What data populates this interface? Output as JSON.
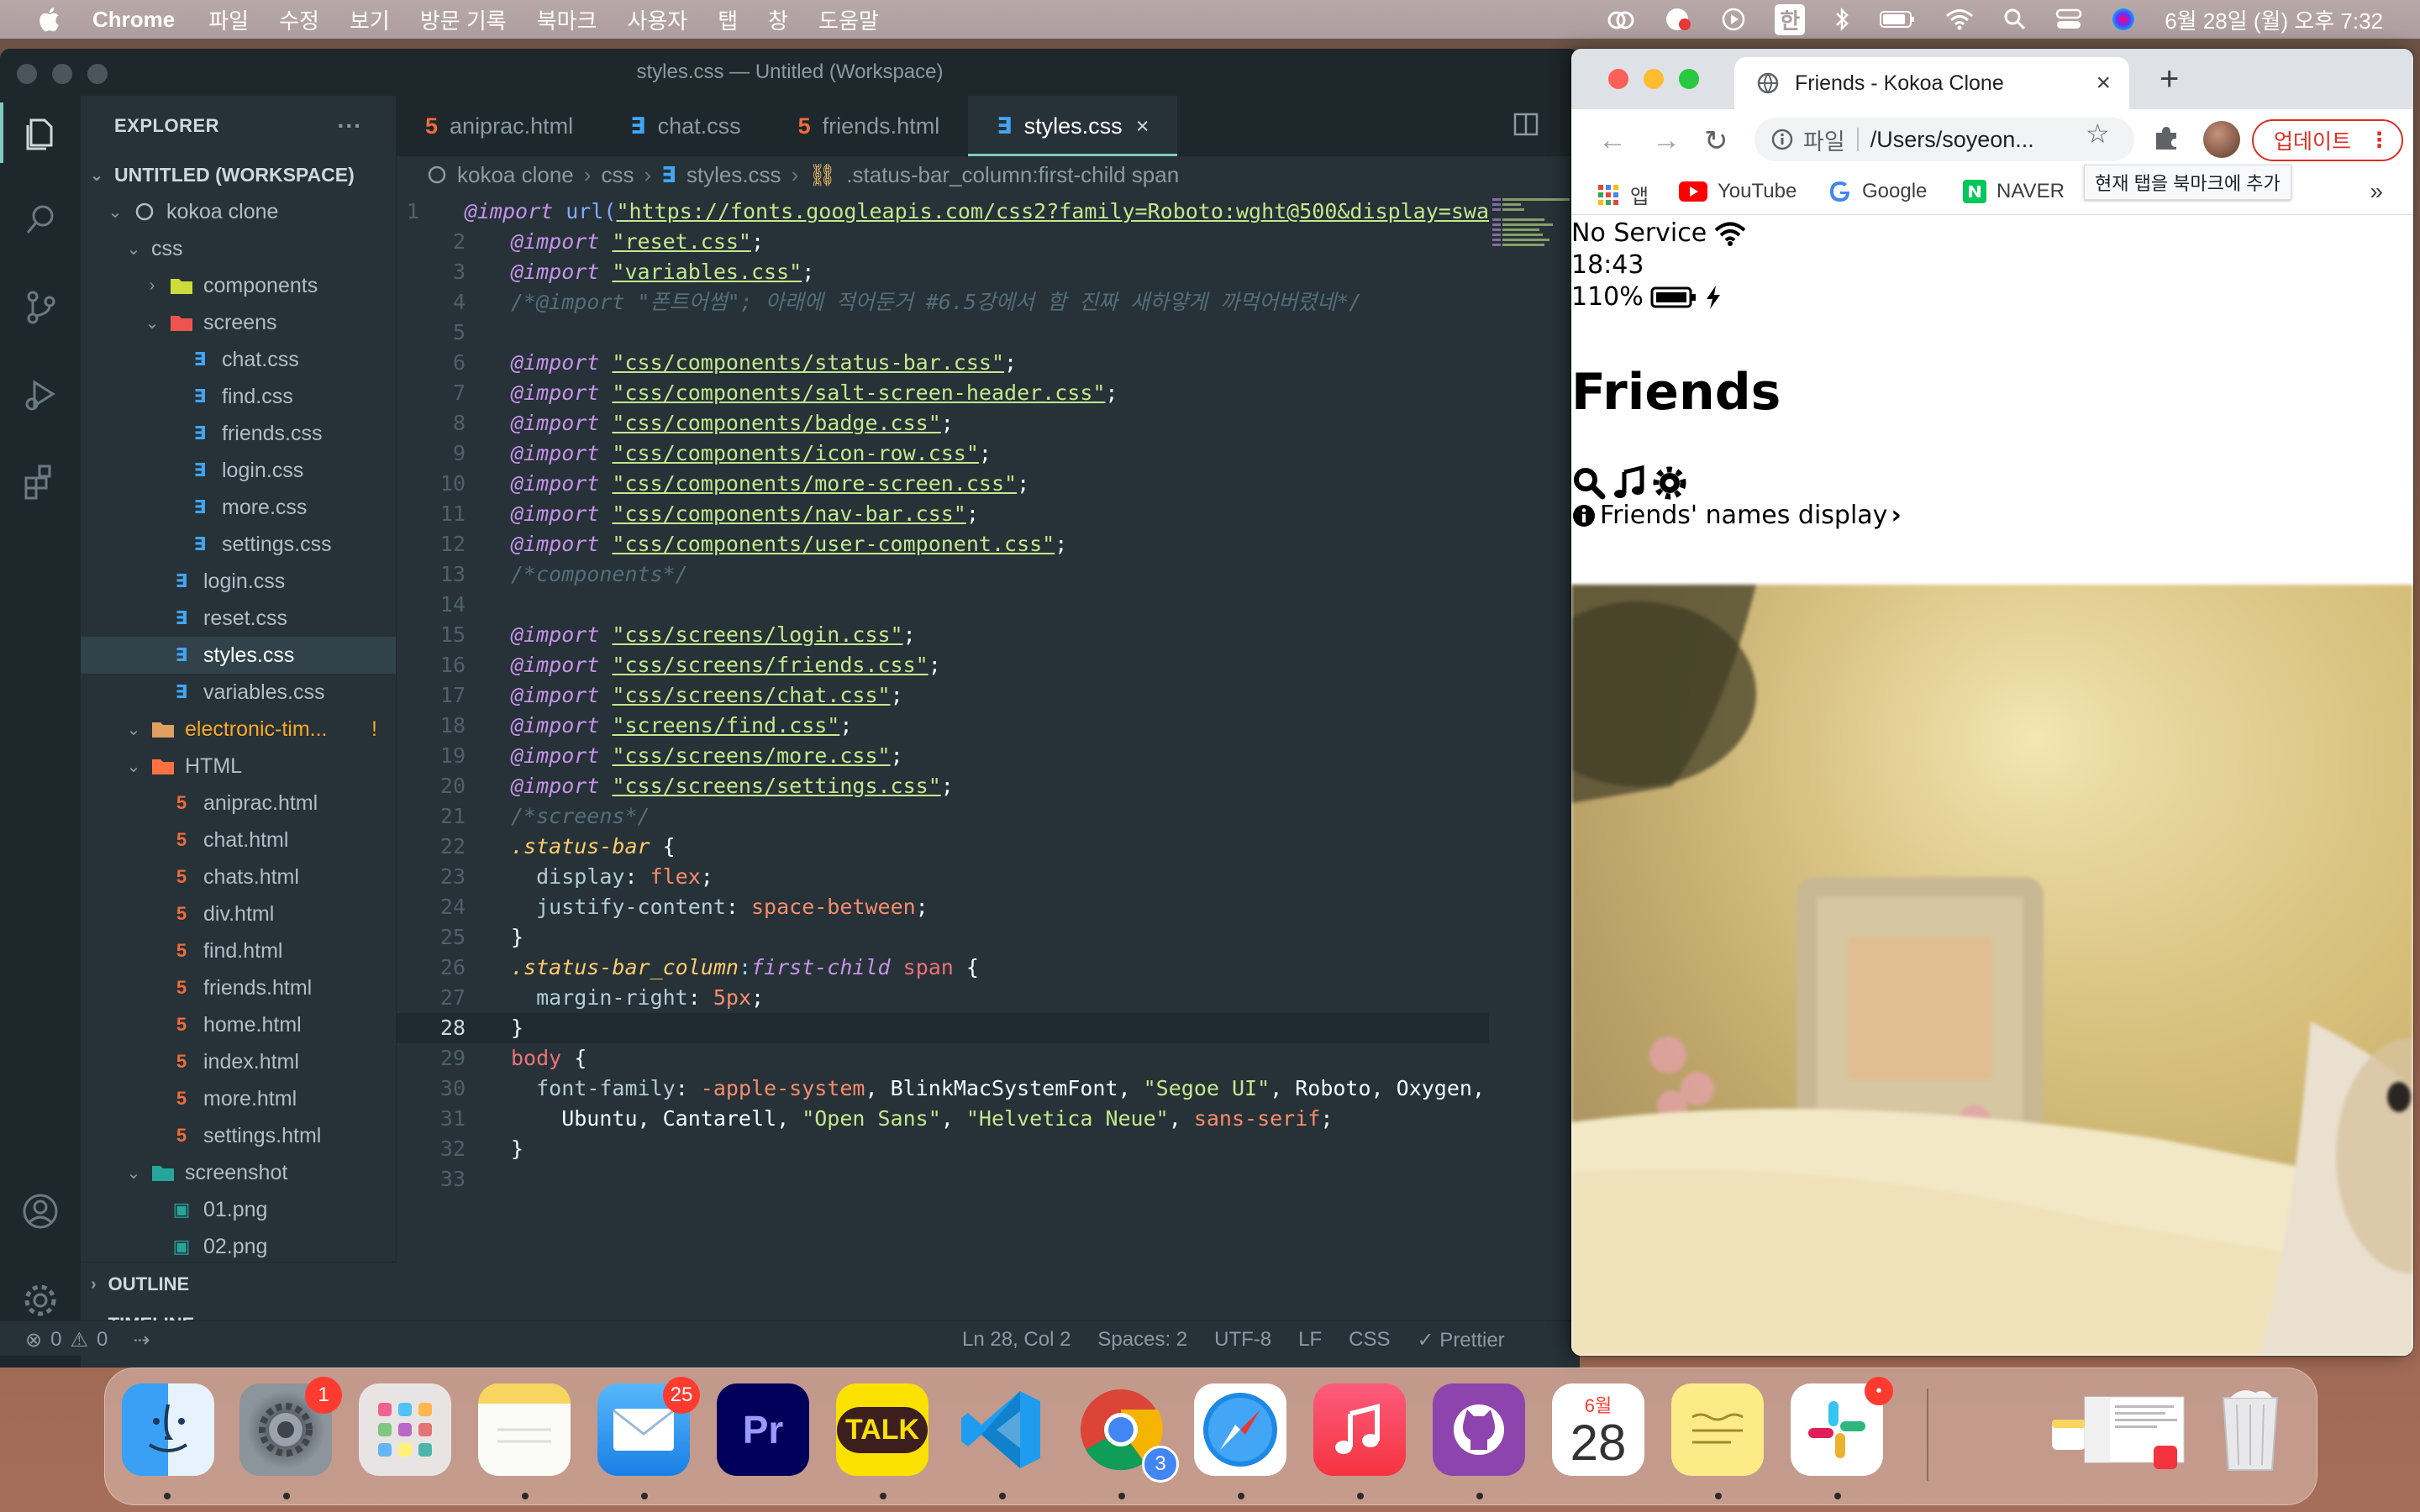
{
  "menubar": {
    "app_name": "Chrome",
    "menus": [
      "파일",
      "수정",
      "보기",
      "방문 기록",
      "북마크",
      "사용자",
      "탭",
      "창",
      "도움말"
    ],
    "input_method": "한",
    "clock": "6월 28일 (월) 오후 7:32"
  },
  "vscode": {
    "title": "styles.css — Untitled (Workspace)",
    "explorer": {
      "header": "EXPLORER",
      "more": "···",
      "workspace": "UNTITLED (WORKSPACE)",
      "items": [
        {
          "label": "kokoa clone",
          "type": "root",
          "depth": 1,
          "expanded": true
        },
        {
          "label": "css",
          "type": "folder",
          "depth": 2,
          "expanded": true
        },
        {
          "label": "components",
          "type": "folder",
          "depth": 3,
          "expanded": false
        },
        {
          "label": "screens",
          "type": "folder",
          "depth": 3,
          "expanded": true
        },
        {
          "label": "chat.css",
          "type": "css",
          "depth": 4
        },
        {
          "label": "find.css",
          "type": "css",
          "depth": 4
        },
        {
          "label": "friends.css",
          "type": "css",
          "depth": 4
        },
        {
          "label": "login.css",
          "type": "css",
          "depth": 4
        },
        {
          "label": "more.css",
          "type": "css",
          "depth": 4
        },
        {
          "label": "settings.css",
          "type": "css",
          "depth": 4
        },
        {
          "label": "login.css",
          "type": "css",
          "depth": 3
        },
        {
          "label": "reset.css",
          "type": "css",
          "depth": 3
        },
        {
          "label": "styles.css",
          "type": "css",
          "depth": 3,
          "selected": true
        },
        {
          "label": "variables.css",
          "type": "css",
          "depth": 3
        },
        {
          "label": "electronic-tim...",
          "type": "folder-warn",
          "depth": 2,
          "expanded": true,
          "badge": "!"
        },
        {
          "label": "HTML",
          "type": "folder",
          "depth": 2,
          "expanded": true
        },
        {
          "label": "aniprac.html",
          "type": "html",
          "depth": 3
        },
        {
          "label": "chat.html",
          "type": "html",
          "depth": 3
        },
        {
          "label": "chats.html",
          "type": "html",
          "depth": 3
        },
        {
          "label": "div.html",
          "type": "html",
          "depth": 3
        },
        {
          "label": "find.html",
          "type": "html",
          "depth": 3
        },
        {
          "label": "friends.html",
          "type": "html",
          "depth": 3
        },
        {
          "label": "home.html",
          "type": "html",
          "depth": 3
        },
        {
          "label": "index.html",
          "type": "html",
          "depth": 3
        },
        {
          "label": "more.html",
          "type": "html",
          "depth": 3
        },
        {
          "label": "settings.html",
          "type": "html",
          "depth": 3
        },
        {
          "label": "screenshot",
          "type": "folder",
          "depth": 2,
          "expanded": true
        },
        {
          "label": "01.png",
          "type": "png",
          "depth": 3
        },
        {
          "label": "02.png",
          "type": "png",
          "depth": 3
        }
      ],
      "outline": "OUTLINE",
      "timeline": "TIMELINE"
    },
    "tabs": [
      {
        "label": "aniprac.html",
        "type": "html",
        "active": false
      },
      {
        "label": "chat.css",
        "type": "css",
        "active": false
      },
      {
        "label": "friends.html",
        "type": "html",
        "active": false
      },
      {
        "label": "styles.css",
        "type": "css",
        "active": true
      }
    ],
    "breadcrumb": [
      "kokoa clone",
      "css",
      "styles.css",
      ".status-bar_column:first-child span"
    ],
    "code": [
      [
        [
          "kw",
          "@import"
        ],
        [
          "t",
          " "
        ],
        [
          "fn",
          "url("
        ],
        [
          "str",
          "\"https://fonts.googleapis.com/css2?family=Roboto:wght@500&display=swa"
        ]
      ],
      [
        [
          "kw",
          "@import"
        ],
        [
          "t",
          " "
        ],
        [
          "str",
          "\"reset.css\""
        ],
        [
          "t",
          ";"
        ]
      ],
      [
        [
          "kw",
          "@import"
        ],
        [
          "t",
          " "
        ],
        [
          "str",
          "\"variables.css\""
        ],
        [
          "t",
          ";"
        ]
      ],
      [
        [
          "cm",
          "/*@import \"폰트어썸\"; 아래에 적어둔거 #6.5강에서 함 진짜 새하얗게 까먹어버렸네*/"
        ]
      ],
      [],
      [
        [
          "kw",
          "@import"
        ],
        [
          "t",
          " "
        ],
        [
          "str",
          "\"css/components/status-bar.css\""
        ],
        [
          "t",
          ";"
        ]
      ],
      [
        [
          "kw",
          "@import"
        ],
        [
          "t",
          " "
        ],
        [
          "str",
          "\"css/components/salt-screen-header.css\""
        ],
        [
          "t",
          ";"
        ]
      ],
      [
        [
          "kw",
          "@import"
        ],
        [
          "t",
          " "
        ],
        [
          "str",
          "\"css/components/badge.css\""
        ],
        [
          "t",
          ";"
        ]
      ],
      [
        [
          "kw",
          "@import"
        ],
        [
          "t",
          " "
        ],
        [
          "str",
          "\"css/components/icon-row.css\""
        ],
        [
          "t",
          ";"
        ]
      ],
      [
        [
          "kw",
          "@import"
        ],
        [
          "t",
          " "
        ],
        [
          "str",
          "\"css/components/more-screen.css\""
        ],
        [
          "t",
          ";"
        ]
      ],
      [
        [
          "kw",
          "@import"
        ],
        [
          "t",
          " "
        ],
        [
          "str",
          "\"css/components/nav-bar.css\""
        ],
        [
          "t",
          ";"
        ]
      ],
      [
        [
          "kw",
          "@import"
        ],
        [
          "t",
          " "
        ],
        [
          "str",
          "\"css/components/user-component.css\""
        ],
        [
          "t",
          ";"
        ]
      ],
      [
        [
          "cm",
          "/*components*/"
        ]
      ],
      [],
      [
        [
          "kw",
          "@import"
        ],
        [
          "t",
          " "
        ],
        [
          "str",
          "\"css/screens/login.css\""
        ],
        [
          "t",
          ";"
        ]
      ],
      [
        [
          "kw",
          "@import"
        ],
        [
          "t",
          " "
        ],
        [
          "str",
          "\"css/screens/friends.css\""
        ],
        [
          "t",
          ";"
        ]
      ],
      [
        [
          "kw",
          "@import"
        ],
        [
          "t",
          " "
        ],
        [
          "str",
          "\"css/screens/chat.css\""
        ],
        [
          "t",
          ";"
        ]
      ],
      [
        [
          "kw",
          "@import"
        ],
        [
          "t",
          " "
        ],
        [
          "str",
          "\"screens/find.css\""
        ],
        [
          "t",
          ";"
        ]
      ],
      [
        [
          "kw",
          "@import"
        ],
        [
          "t",
          " "
        ],
        [
          "str",
          "\"css/screens/more.css\""
        ],
        [
          "t",
          ";"
        ]
      ],
      [
        [
          "kw",
          "@import"
        ],
        [
          "t",
          " "
        ],
        [
          "str",
          "\"css/screens/settings.css\""
        ],
        [
          "t",
          ";"
        ]
      ],
      [
        [
          "cm",
          "/*screens*/"
        ]
      ],
      [
        [
          "sel",
          ".status-bar"
        ],
        [
          "t",
          " {"
        ]
      ],
      [
        [
          "t",
          "  "
        ],
        [
          "pr",
          "display"
        ],
        [
          "t",
          ": "
        ],
        [
          "val",
          "flex"
        ],
        [
          "t",
          ";"
        ]
      ],
      [
        [
          "t",
          "  "
        ],
        [
          "pr",
          "justify-content"
        ],
        [
          "t",
          ": "
        ],
        [
          "val",
          "space-between"
        ],
        [
          "t",
          ";"
        ]
      ],
      [
        [
          "t",
          "}"
        ]
      ],
      [
        [
          "sel",
          ".status-bar_column"
        ],
        [
          "pun",
          ":"
        ],
        [
          "kw",
          "first-child"
        ],
        [
          "t",
          " "
        ],
        [
          "tag",
          "span"
        ],
        [
          "t",
          " {"
        ]
      ],
      [
        [
          "t",
          "  "
        ],
        [
          "pr",
          "margin-right"
        ],
        [
          "t",
          ": "
        ],
        [
          "val",
          "5px"
        ],
        [
          "t",
          ";"
        ]
      ],
      [
        [
          "t",
          "}"
        ]
      ],
      [
        [
          "tag",
          "body"
        ],
        [
          "t",
          " {"
        ]
      ],
      [
        [
          "t",
          "  "
        ],
        [
          "pr",
          "font-family"
        ],
        [
          "t",
          ": "
        ],
        [
          "val",
          "-apple-system"
        ],
        [
          "t",
          ", BlinkMacSystemFont, "
        ],
        [
          "str2",
          "\"Segoe UI\""
        ],
        [
          "t",
          ", Roboto, Oxygen,"
        ]
      ],
      [
        [
          "t",
          "    Ubuntu, Cantarell, "
        ],
        [
          "str2",
          "\"Open Sans\""
        ],
        [
          "t",
          ", "
        ],
        [
          "str2",
          "\"Helvetica Neue\""
        ],
        [
          "t",
          ", "
        ],
        [
          "val",
          "sans-serif"
        ],
        [
          "t",
          ";"
        ]
      ],
      [
        [
          "t",
          "}"
        ]
      ],
      []
    ],
    "current_line": 28,
    "status": {
      "errors": "0",
      "warnings": "0",
      "position": "Ln 28, Col 2",
      "spaces": "Spaces: 2",
      "encoding": "UTF-8",
      "eol": "LF",
      "language": "CSS",
      "formatter": "✓ Prettier"
    }
  },
  "chrome": {
    "tab_title": "Friends - Kokoa Clone",
    "address_scheme": "파일",
    "address": "/Users/soyeon...",
    "update_label": "업데이트",
    "bookmark_tooltip": "현재 탭을 북마크에 추가",
    "bookmarks": [
      {
        "label": "앱",
        "icon": "apps-grid-icon"
      },
      {
        "label": "YouTube",
        "icon": "youtube-icon"
      },
      {
        "label": "Google",
        "icon": "google-icon"
      },
      {
        "label": "NAVER",
        "icon": "naver-icon"
      }
    ],
    "page": {
      "status_service": "No Service",
      "status_time": "18:43",
      "status_battery": "110%",
      "title": "Friends",
      "friends_names_display": "Friends' names display"
    }
  },
  "dock": {
    "apps": [
      {
        "name": "finder",
        "label": "",
        "badge": ""
      },
      {
        "name": "system-preferences",
        "label": "",
        "badge": "1"
      },
      {
        "name": "launchpad",
        "label": "",
        "badge": ""
      },
      {
        "name": "notes",
        "label": "",
        "badge": ""
      },
      {
        "name": "mail",
        "label": "",
        "badge": "25"
      },
      {
        "name": "premiere-pro",
        "label": "Pr",
        "badge": ""
      },
      {
        "name": "kakaotalk",
        "label": "TALK",
        "badge": ""
      },
      {
        "name": "vscode",
        "label": "",
        "badge": ""
      },
      {
        "name": "chrome",
        "label": "",
        "badge": "3"
      },
      {
        "name": "safari",
        "label": "",
        "badge": ""
      },
      {
        "name": "music",
        "label": "",
        "badge": ""
      },
      {
        "name": "github-desktop",
        "label": "",
        "badge": ""
      },
      {
        "name": "calendar",
        "label": "28",
        "month": "6월",
        "badge": ""
      },
      {
        "name": "stickies",
        "label": "",
        "badge": ""
      },
      {
        "name": "slack",
        "label": "",
        "badge": "•"
      }
    ]
  },
  "colors": {
    "editor_bg": "#263238",
    "accent": "#80cbc4",
    "css_icon": "#42a5f5",
    "html_icon": "#ef6c3c",
    "update_red": "#d93025"
  }
}
